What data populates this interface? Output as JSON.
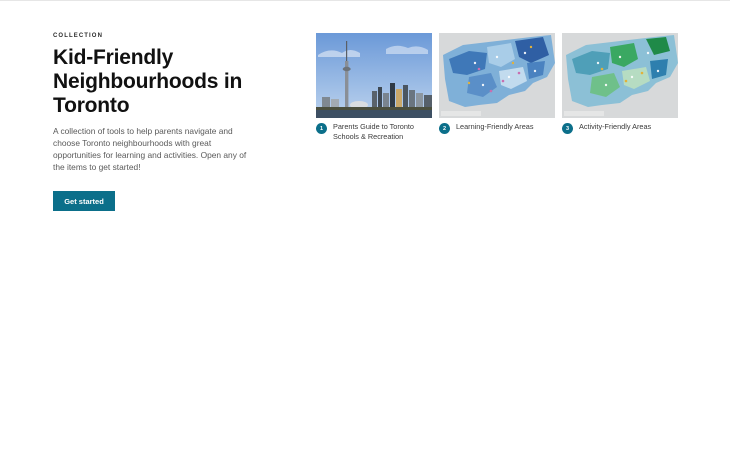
{
  "collection_label": "COLLECTION",
  "title": "Kid-Friendly Neighbourhoods in Toronto",
  "description": "A collection of tools to help parents navigate and choose Toronto neighbourhoods with great opportunities for learning and activities. Open any of the items to get started!",
  "cta_label": "Get started",
  "items": [
    {
      "number": "1",
      "label": "Parents Guide to Toronto Schools & Recreation",
      "thumb": "skyline-photo"
    },
    {
      "number": "2",
      "label": "Learning-Friendly Areas",
      "thumb": "choropleth-map"
    },
    {
      "number": "3",
      "label": "Activity-Friendly Areas",
      "thumb": "choropleth-map"
    }
  ],
  "colors": {
    "accent": "#0b6f8a",
    "map_blue": "#3f78b8",
    "map_green": "#3aa862",
    "map_background": "#d7d9da"
  }
}
